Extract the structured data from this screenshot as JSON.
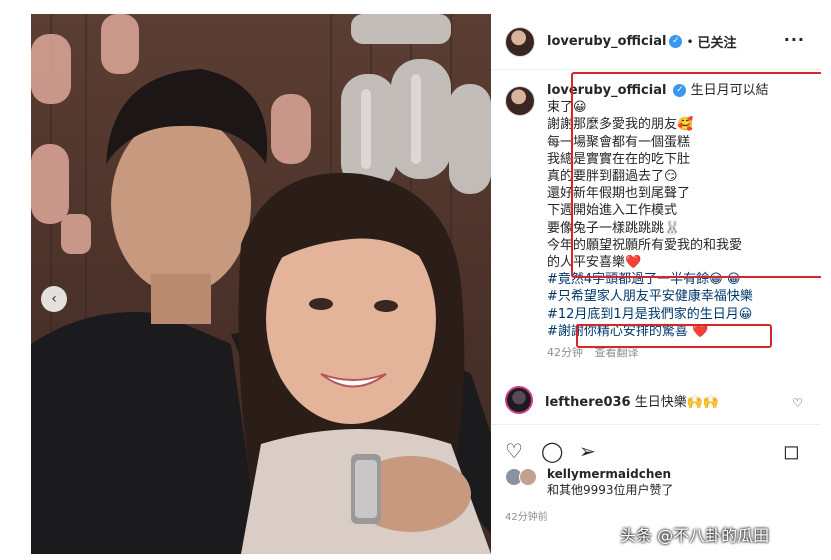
{
  "header": {
    "username": "loveruby_official",
    "verified_mark": "✓",
    "separator": "•",
    "follow_label": "已关注",
    "more_label": "···"
  },
  "caption": {
    "username": "loveruby_official",
    "lines": [
      "生日月可以結",
      "束了😀",
      "謝謝那麼多愛我的朋友🥰",
      "每一場聚會都有一個蛋糕",
      "我總是實實在在的吃下肚",
      "真的要胖到翻過去了😏",
      "還好新年假期也到尾聲了",
      "下週開始進入工作模式",
      "要像兔子一樣跳跳跳🐰",
      "今年的願望祝願所有愛我的和我愛",
      "的人平安喜樂❤️"
    ],
    "hashtags": [
      "#竟然4字頭都過了一半有餘😀 😀",
      "#只希望家人朋友平安健康幸福快樂",
      "#12月底到1月是我們家的生日月😀",
      "#謝謝你精心安排的驚喜 ❤️"
    ],
    "time_ago": "42分钟",
    "translate_label": "查看翻译"
  },
  "comment": {
    "username": "lefthere036",
    "text": "生日快樂🙌🙌",
    "like_icon": "heart-outline-icon"
  },
  "actions": {
    "like": "♡",
    "comment": "◯",
    "share": "➢",
    "save": "◻"
  },
  "likes": {
    "first_user": "kellymermaidchen",
    "others_text": "和其他9993位用户赞了"
  },
  "timestamp": "42分钟前",
  "watermark": "头条 @不八卦的瓜田",
  "carousel_prev": "‹",
  "colors": {
    "highlight_box": "#d8252d",
    "hashtag": "#00376b",
    "verified": "#3897f0"
  }
}
